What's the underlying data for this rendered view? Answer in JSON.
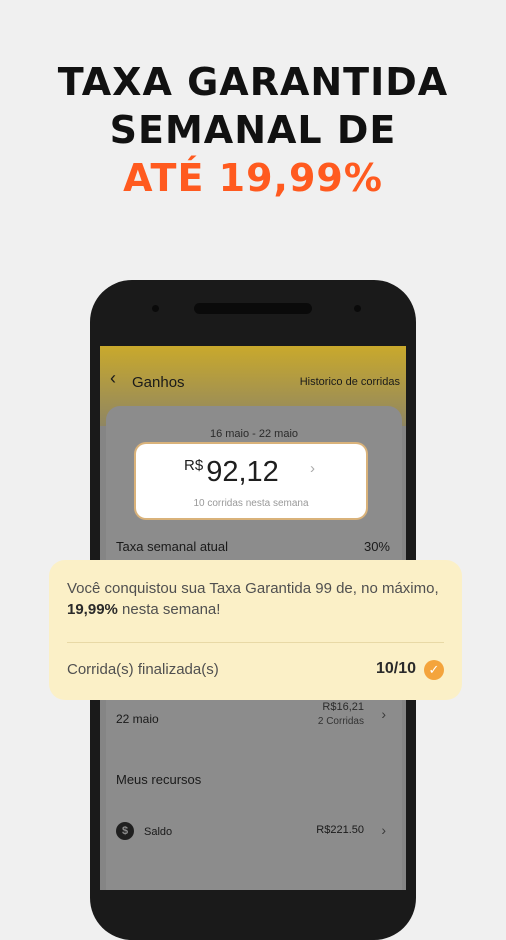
{
  "headline": {
    "line1": "TAXA GARANTIDA",
    "line2": "SEMANAL DE",
    "line3": "ATÉ 19,99%",
    "accent_color": "#ff5a1f"
  },
  "app": {
    "back_icon": "‹",
    "title": "Ganhos",
    "history_link": "Historico de corridas"
  },
  "earnings": {
    "period": "16 maio - 22 maio",
    "currency": "R$",
    "amount": "92,12",
    "rides_text": "10 corridas nesta semana"
  },
  "rate": {
    "label": "Taxa semanal atual",
    "value": "30%"
  },
  "day_row": {
    "date": "22 maio",
    "amount": "R$16,21",
    "rides": "2 Corridas"
  },
  "resources": {
    "title": "Meus recursos",
    "coin_icon": "$",
    "saldo_label": "Saldo",
    "saldo_value": "R$221.50"
  },
  "notice": {
    "msg_pre": "Você conquistou sua Taxa Garantida 99 de, no máximo, ",
    "msg_bold": "19,99%",
    "msg_post": " nesta semana!",
    "status_label": "Corrida(s) finalizada(s)",
    "status_value": "10/10",
    "check_icon": "✓",
    "check_color": "#f4a43c"
  }
}
